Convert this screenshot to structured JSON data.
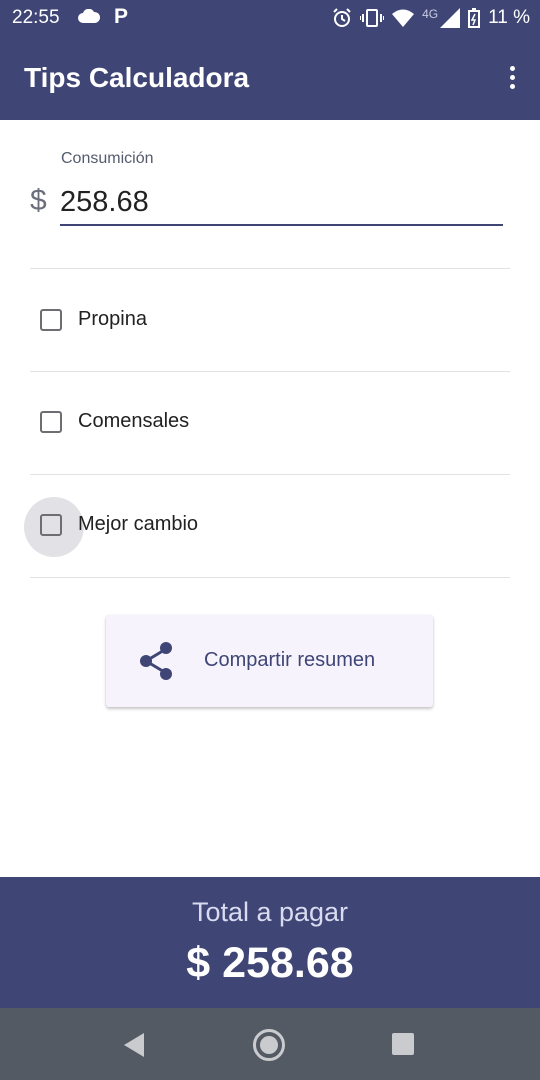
{
  "status_bar": {
    "time": "22:55",
    "app_icon_letter": "P",
    "network": "4G",
    "battery": "11 %",
    "icons": [
      "cloud-icon",
      "alarm-icon",
      "vibrate-icon",
      "wifi-icon",
      "signal-icon",
      "battery-icon"
    ]
  },
  "app_bar": {
    "title": "Tips Calculadora",
    "menu_icon": "more-vert-icon"
  },
  "consumption": {
    "label": "Consumición",
    "currency": "$",
    "value": "258.68"
  },
  "options": [
    {
      "label": "Propina",
      "checked": false
    },
    {
      "label": "Comensales",
      "checked": false
    },
    {
      "label": "Mejor cambio",
      "checked": false
    }
  ],
  "share": {
    "label": "Compartir resumen",
    "icon": "share-icon"
  },
  "total": {
    "label": "Total a pagar",
    "value": "$ 258.68"
  },
  "nav": {
    "icons": [
      "back-icon",
      "home-icon",
      "recents-icon"
    ]
  },
  "colors": {
    "primary": "#3f4675",
    "button_bg": "#f6f3fd",
    "nav_bg": "#545a63"
  }
}
